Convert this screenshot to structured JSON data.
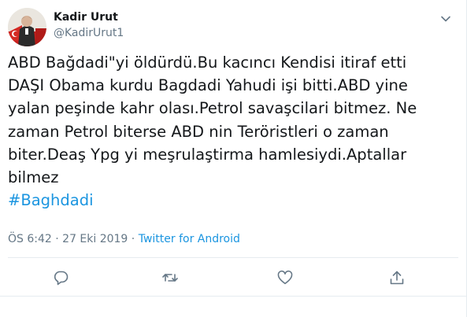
{
  "tweet": {
    "author": {
      "name": "Kadir Urut",
      "handle": "@KadirUrut1"
    },
    "lines": [
      "ABD Bağdadi\"yi öldürdü.Bu kacıncı Kendisi itiraf etti",
      "DAŞI Obama kurdu Bagdadi Yahudi işi bitti.ABD yine",
      "yalan peşinde kahr olası.Petrol savaşcilari bitmez. Ne",
      "zaman Petrol biterse ABD nin Teröristleri o zaman",
      "biter.Deaş Ypg yi meşrulaştirma hamlesiydi.Aptallar",
      "bilmez"
    ],
    "hashtag": "#Baghdadi",
    "time": "ÖS 6:42",
    "separator": " · ",
    "date": "27 Eki 2019",
    "source": "Twitter for Android"
  },
  "icons": {
    "more": "chevron-down-icon",
    "reply": "reply-icon",
    "retweet": "retweet-icon",
    "like": "heart-icon",
    "share": "share-icon"
  },
  "colors": {
    "text": "#14171a",
    "secondary": "#657786",
    "link": "#1b95e0",
    "border": "#e6ecf0"
  }
}
